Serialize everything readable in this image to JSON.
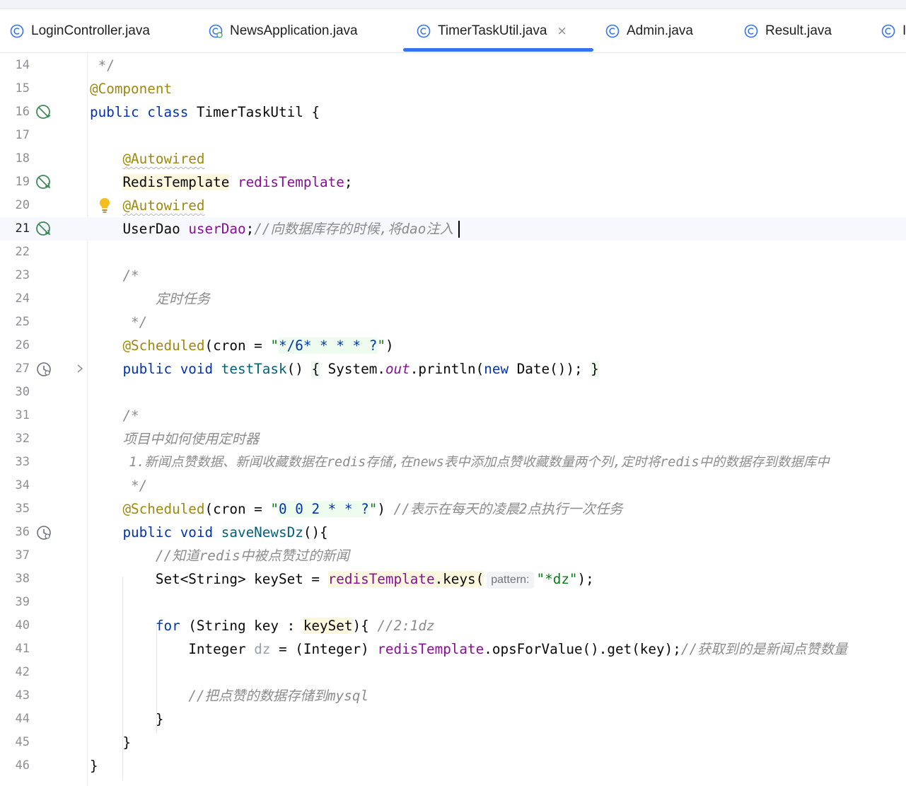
{
  "tabs": [
    {
      "label": "LoginController.java"
    },
    {
      "label": "NewsApplication.java"
    },
    {
      "label": "TimerTaskUtil.java",
      "close": "×"
    },
    {
      "label": "Admin.java"
    },
    {
      "label": "Result.java"
    },
    {
      "label": "I"
    }
  ],
  "editor": {
    "active_line": 21,
    "colors": {
      "keyword": "#0033b3",
      "annotation": "#9e880d",
      "field": "#871094",
      "comment": "#8c8c8c",
      "string": "#067d17",
      "method": "#00627a",
      "accent": "#3574f0"
    },
    "lines": [
      {
        "n": "14",
        "t": [
          "*/"
        ]
      },
      {
        "n": "15",
        "t": [
          "@Component"
        ]
      },
      {
        "n": "16",
        "t": [
          "public",
          "class",
          "TimerTaskUtil",
          "{"
        ]
      },
      {
        "n": "17",
        "t": []
      },
      {
        "n": "18",
        "t": [
          "@Autowired"
        ]
      },
      {
        "n": "19",
        "t": [
          "RedisTemplate",
          "redisTemplate",
          ";"
        ]
      },
      {
        "n": "20",
        "t": [
          "@Autowired"
        ]
      },
      {
        "n": "21",
        "t": [
          "UserDao",
          "userDao",
          ";",
          "//向数据库存的时候,将dao注入"
        ]
      },
      {
        "n": "22",
        "t": []
      },
      {
        "n": "23",
        "t": [
          "/*"
        ]
      },
      {
        "n": "24",
        "t": [
          "定时任务"
        ]
      },
      {
        "n": "25",
        "t": [
          "*/"
        ]
      },
      {
        "n": "26",
        "t": [
          "@Scheduled",
          "(cron = ",
          "\"",
          "*/6* * * * ?",
          "\"",
          ")"
        ]
      },
      {
        "n": "27",
        "t": [
          "public",
          "void",
          "testTask",
          "()",
          "{",
          "System.",
          "out",
          ".println(",
          "new",
          "Date());",
          "}"
        ]
      },
      {
        "n": "30",
        "t": []
      },
      {
        "n": "31",
        "t": [
          "/*"
        ]
      },
      {
        "n": "32",
        "t": [
          "项目中如何使用定时器"
        ]
      },
      {
        "n": "33",
        "t": [
          "1.新闻点赞数据、新闻收藏数据在redis存储,在news表中添加点赞收藏数量两个列,定时将redis中的数据存到数据库中"
        ]
      },
      {
        "n": "34",
        "t": [
          "*/"
        ]
      },
      {
        "n": "35",
        "t": [
          "@Scheduled",
          "(cron = ",
          "\"",
          "0 0 2 * * ?",
          "\"",
          ")",
          "//表示在每天的凌晨2点执行一次任务"
        ]
      },
      {
        "n": "36",
        "t": [
          "public",
          "void",
          "saveNewsDz",
          "(){"
        ]
      },
      {
        "n": "37",
        "t": [
          "//知道redis中被点赞过的新闻"
        ]
      },
      {
        "n": "38",
        "t": [
          "Set<String> keySet = ",
          "redisTemplate",
          ".keys(",
          "pattern:",
          "\"*dz\"",
          ");"
        ]
      },
      {
        "n": "39",
        "t": []
      },
      {
        "n": "40",
        "t": [
          "for",
          " (String key : ",
          "keySet",
          "){",
          "//2:1dz"
        ]
      },
      {
        "n": "41",
        "t": [
          "Integer ",
          "dz",
          " = (Integer) ",
          "redisTemplate",
          ".opsForValue().get(key);",
          "//获取到的是新闻点赞数量"
        ]
      },
      {
        "n": "42",
        "t": []
      },
      {
        "n": "43",
        "t": [
          "//把点赞的数据存储到mysql"
        ]
      },
      {
        "n": "44",
        "t": [
          "}"
        ]
      },
      {
        "n": "45",
        "t": [
          "}"
        ]
      },
      {
        "n": "46",
        "t": [
          "}"
        ]
      }
    ]
  }
}
